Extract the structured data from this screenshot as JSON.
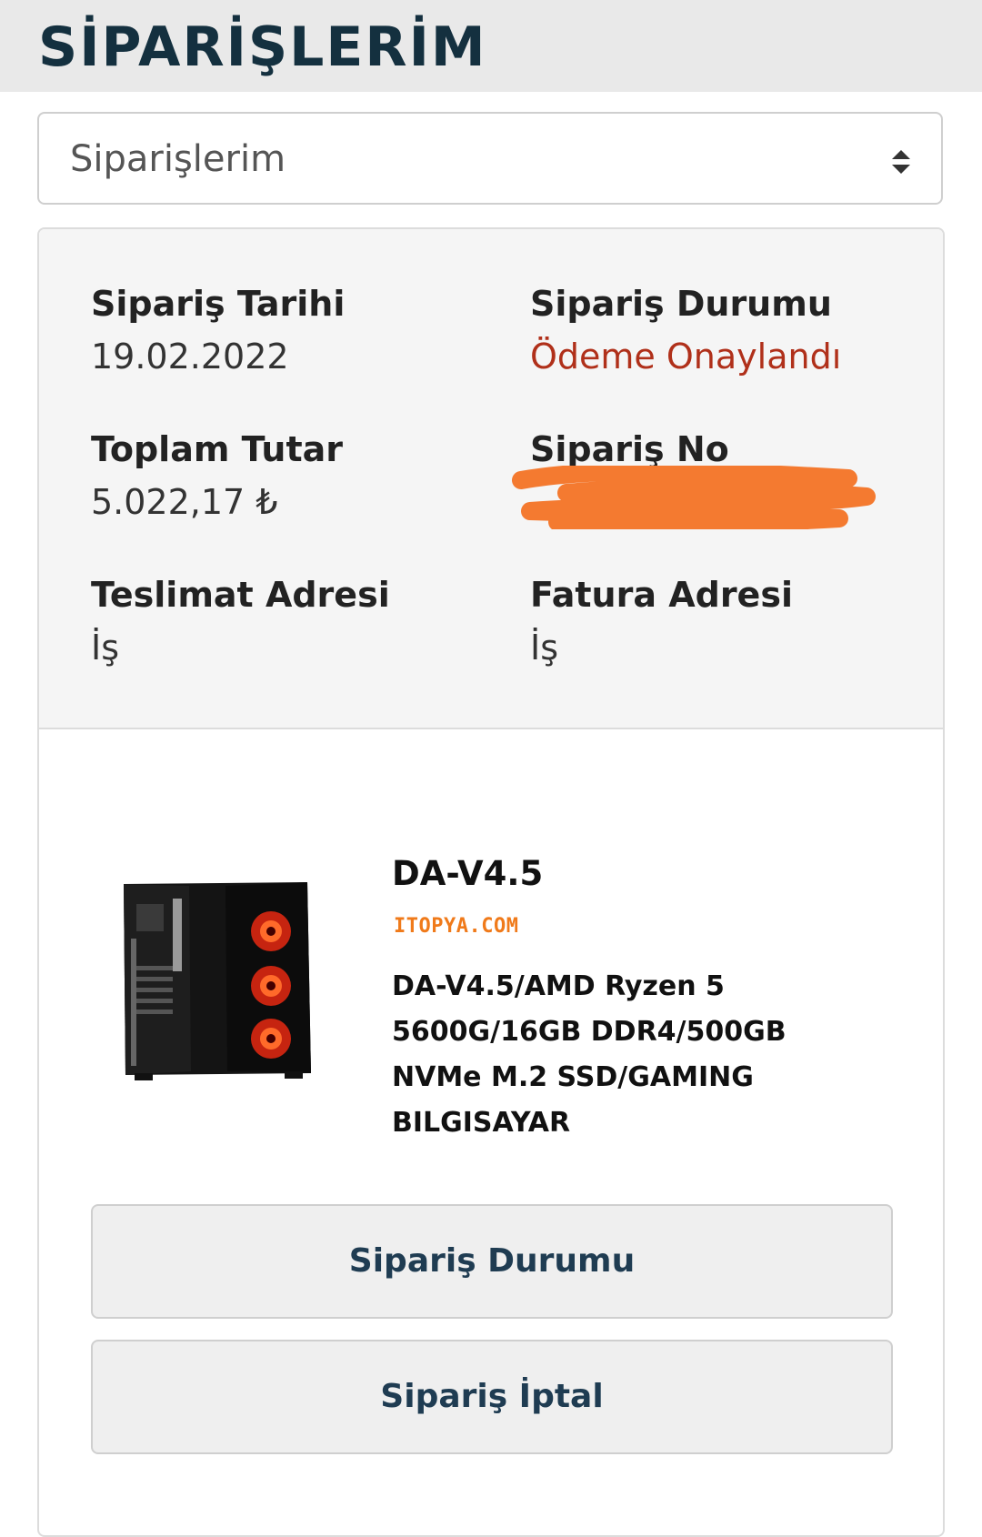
{
  "header": {
    "title": "SİPARİŞLERİM"
  },
  "select": {
    "value": "Siparişlerim",
    "icon": "sort-arrows-icon"
  },
  "order": {
    "date_label": "Sipariş Tarihi",
    "date_value": "19.02.2022",
    "status_label": "Sipariş Durumu",
    "status_value": "Ödeme Onaylandı",
    "total_label": "Toplam Tutar",
    "total_value": "5.022,17 ₺",
    "number_label": "Sipariş No",
    "delivery_label": "Teslimat Adresi",
    "delivery_value": "İş",
    "invoice_label": "Fatura Adresi",
    "invoice_value": "İş"
  },
  "product": {
    "name": "DA-V4.5",
    "brand": "ITOPYA.COM",
    "description": "DA-V4.5/AMD Ryzen 5 5600G/16GB DDR4/500GB NVMe M.2 SSD/GAMING BILGISAYAR"
  },
  "buttons": {
    "status": "Sipariş Durumu",
    "cancel": "Sipariş İptal"
  },
  "colors": {
    "header_bg": "#e9e9e9",
    "title": "#14303f",
    "status": "#b0301a",
    "brand": "#f07a1a",
    "redaction": "#f47a30",
    "button_text": "#1f3c52"
  }
}
